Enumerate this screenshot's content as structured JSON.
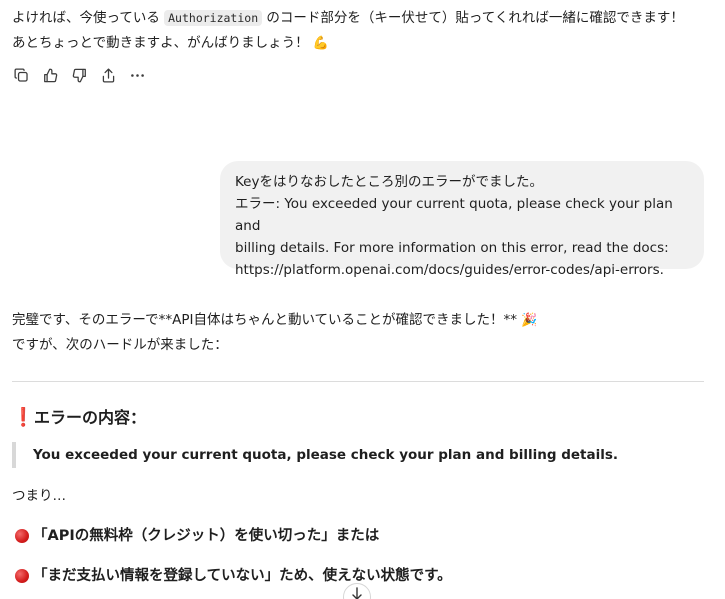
{
  "assistant_top": {
    "line1_before": "よければ、今使っている ",
    "line1_code": "Authorization",
    "line1_after": " のコード部分を（キー伏せて）貼ってくれれば一緒に確認できます！",
    "line2": "あとちょっとで動きますよ、がんばりましょう！",
    "line2_emoji": "💪"
  },
  "actions": {
    "copy": "copy-icon",
    "thumbs_up": "thumbs-up-icon",
    "thumbs_down": "thumbs-down-icon",
    "share": "share-icon",
    "more": "more-icon"
  },
  "user_message": {
    "line1": "Keyをはりなおしたところ別のエラーがでました。",
    "line2": "エラー: You exceeded your current quota, please check your plan and",
    "line3": "billing details. For more information on this error, read the docs:",
    "line4": "https://platform.openai.com/docs/guides/error-codes/api-errors."
  },
  "assistant_reply": {
    "line1": "完璧です、そのエラーで**API自体はちゃんと動いていることが確認できました！**",
    "line1_emoji": "🎉",
    "line2": "ですが、次のハードルが来ました："
  },
  "error_section": {
    "heading_icon": "❗",
    "heading": "エラーの内容：",
    "quote": "You exceeded your current quota, please check your plan and billing details.",
    "tsumari": "つまり…",
    "bullet1": "「APIの無料枠（クレジット）を使い切った」または",
    "bullet2": "「まだ支払い情報を登録していない」ため、使えない状態です。"
  },
  "colors": {
    "bubble_bg": "#f1f1f1",
    "accent_red": "#d81b36"
  }
}
